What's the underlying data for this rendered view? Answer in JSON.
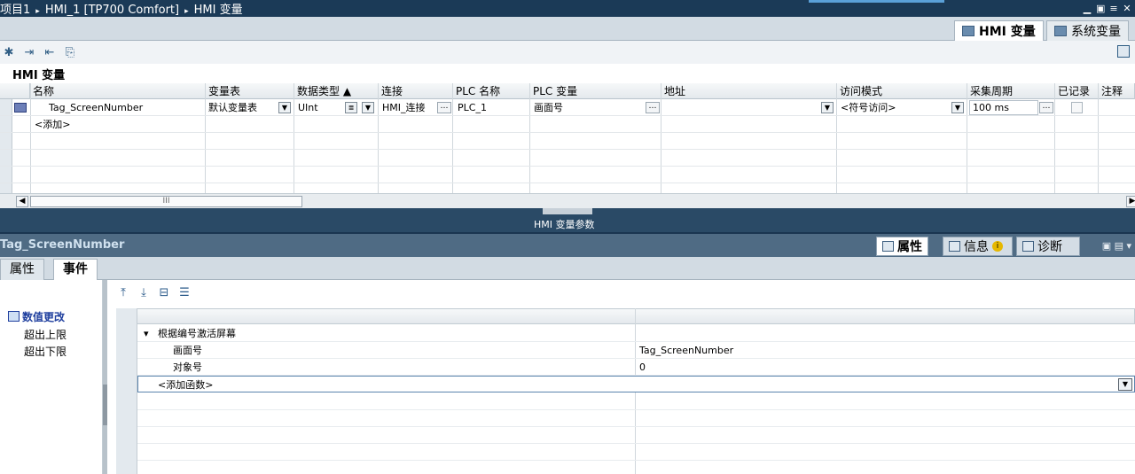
{
  "titlebar": {
    "crumbs": [
      "项目1",
      "HMI_1 [TP700 Comfort]",
      "HMI 变量"
    ],
    "sep": "▸"
  },
  "top_tabs": [
    {
      "label": "HMI 变量",
      "icon": "table-icon",
      "active": true
    },
    {
      "label": "系统变量",
      "icon": "table-icon",
      "active": false
    }
  ],
  "section_title": "HMI 变量",
  "grid": {
    "headers": [
      "名称",
      "变量表",
      "数据类型 ▲",
      "连接",
      "PLC 名称",
      "PLC 变量",
      "地址",
      "访问模式",
      "采集周期",
      "已记录",
      "注释"
    ],
    "rows": [
      {
        "name": "Tag_ScreenNumber",
        "table": "默认变量表",
        "datatype": "UInt",
        "connection": "HMI_连接",
        "plc_name": "PLC_1",
        "plc_tag": "画面号",
        "address": "",
        "access_mode": "<符号访问>",
        "cycle": "100 ms",
        "logged": false,
        "comment": ""
      }
    ],
    "add_row": "<添加>",
    "hscroll_thumb": "III"
  },
  "splitter_label": "HMI 变量参数",
  "inspector": {
    "object_name": "Tag_ScreenNumber",
    "tabs": [
      {
        "label": "属性",
        "active": true
      },
      {
        "label": "信息",
        "active": false
      },
      {
        "label": "诊断",
        "active": false
      }
    ],
    "info_badge": "i",
    "subtabs": [
      {
        "label": "属性",
        "active": false
      },
      {
        "label": "事件",
        "active": true
      }
    ],
    "events": [
      {
        "label": "数值更改",
        "selected": true
      },
      {
        "label": "超出上限",
        "selected": false
      },
      {
        "label": "超出下限",
        "selected": false
      }
    ],
    "function_list": {
      "function_name": "根据编号激活屏幕",
      "params": [
        {
          "name": "画面号",
          "value": "Tag_ScreenNumber"
        },
        {
          "name": "对象号",
          "value": "0"
        }
      ],
      "add_function": "<添加函数>"
    }
  },
  "colors": {
    "titlebar": "#1b3a57",
    "splitter": "#2a4a66",
    "inspector_header": "#4f6b84",
    "selected_event": "#1f3f9e"
  }
}
